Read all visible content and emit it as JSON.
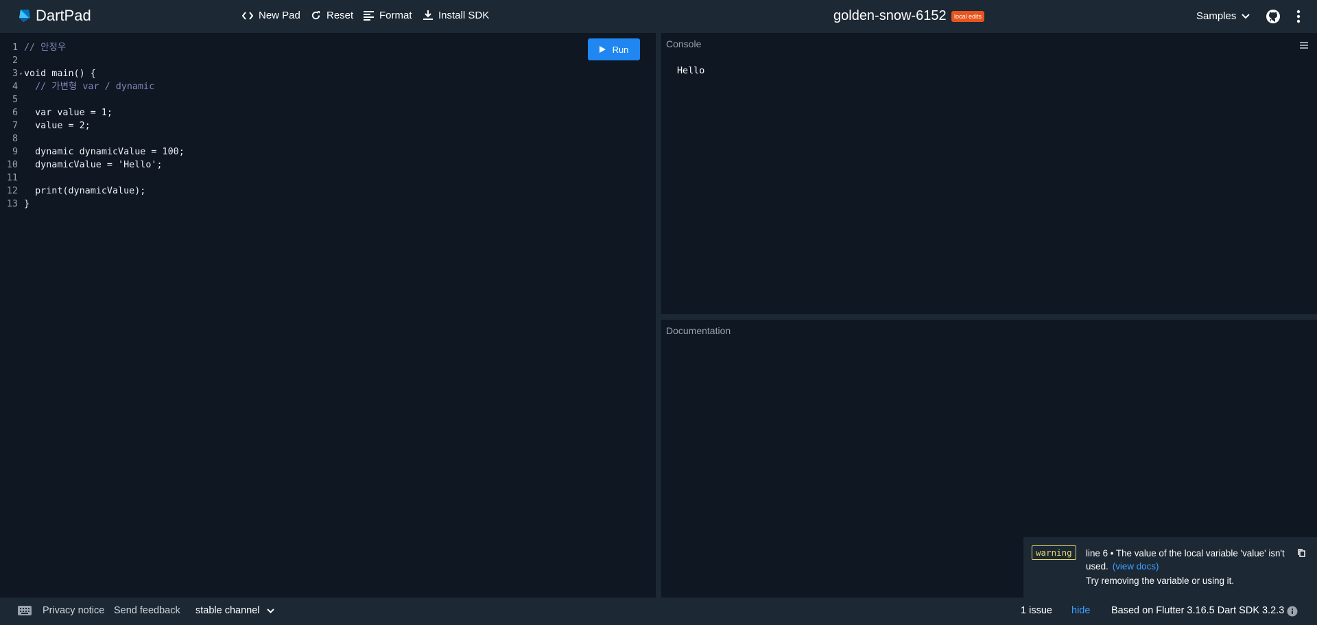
{
  "app": {
    "name": "DartPad"
  },
  "toolbar": {
    "new_pad": "New Pad",
    "reset": "Reset",
    "format": "Format",
    "install_sdk": "Install SDK"
  },
  "pad": {
    "title": "golden-snow-6152",
    "badge": "local edits"
  },
  "header_right": {
    "samples": "Samples"
  },
  "editor": {
    "run_label": "Run",
    "lines": [
      {
        "n": "1",
        "fold": "",
        "code": "// 안정우"
      },
      {
        "n": "2",
        "fold": "",
        "code": ""
      },
      {
        "n": "3",
        "fold": "▾",
        "code": "void main() {"
      },
      {
        "n": "4",
        "fold": "",
        "code": "  // 가변형 var / dynamic"
      },
      {
        "n": "5",
        "fold": "",
        "code": ""
      },
      {
        "n": "6",
        "fold": "",
        "code": "  var value = 1;"
      },
      {
        "n": "7",
        "fold": "",
        "code": "  value = 2;"
      },
      {
        "n": "8",
        "fold": "",
        "code": ""
      },
      {
        "n": "9",
        "fold": "",
        "code": "  dynamic dynamicValue = 100;"
      },
      {
        "n": "10",
        "fold": "",
        "code": "  dynamicValue = 'Hello';"
      },
      {
        "n": "11",
        "fold": "",
        "code": ""
      },
      {
        "n": "12",
        "fold": "",
        "code": "  print(dynamicValue);"
      },
      {
        "n": "13",
        "fold": "",
        "code": "}"
      }
    ]
  },
  "console": {
    "label": "Console",
    "output": "Hello"
  },
  "docs": {
    "label": "Documentation"
  },
  "issue": {
    "severity": "warning",
    "message": "line 6 • The value of the local variable 'value' isn't used.",
    "link": "(view docs)",
    "fix": "Try removing the variable or using it."
  },
  "footer": {
    "privacy": "Privacy notice",
    "feedback": "Send feedback",
    "channel": "stable channel",
    "issues": "1 issue",
    "hide": "hide",
    "version": "Based on Flutter 3.16.5 Dart SDK 3.2.3"
  },
  "colors": {
    "accent": "#1f86f2",
    "badge": "#e8541e",
    "warning": "#e6d76b",
    "link": "#3d9fff"
  }
}
